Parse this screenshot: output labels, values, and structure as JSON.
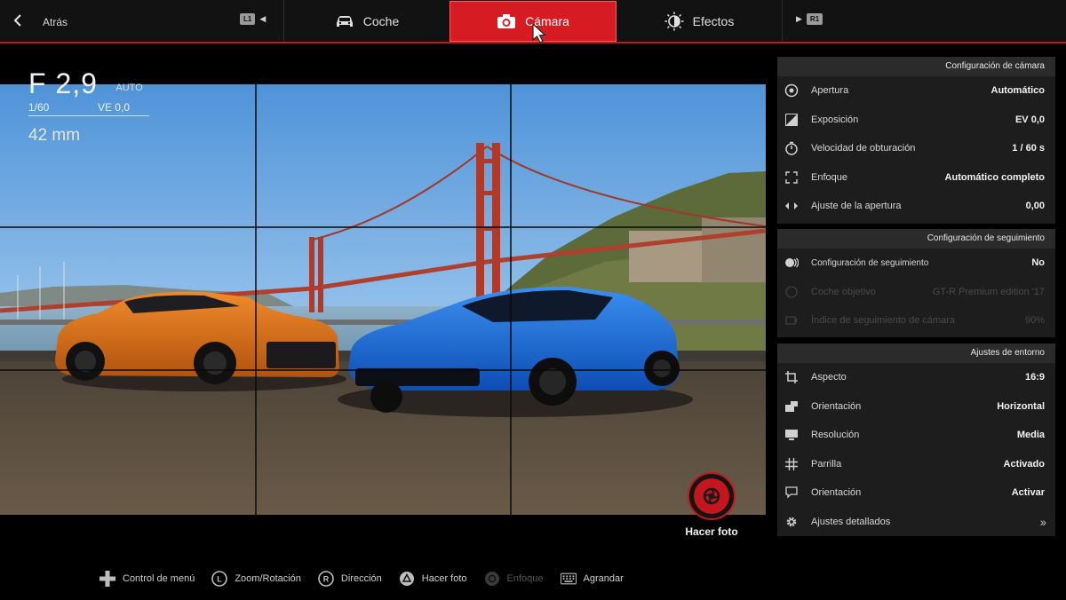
{
  "topbar": {
    "back_label": "Atrás",
    "left_button": "L1",
    "right_button": "R1",
    "tabs": [
      {
        "label": "Coche",
        "icon": "car-icon",
        "active": false
      },
      {
        "label": "Cámara",
        "icon": "camera-icon",
        "active": true
      },
      {
        "label": "Efectos",
        "icon": "effects-icon",
        "active": false
      }
    ],
    "accent": "#d61c22"
  },
  "hud": {
    "aperture": "F 2,9",
    "mode": "AUTO",
    "shutter": "1/60",
    "ev": "VE 0,0",
    "focal": "42 mm"
  },
  "shutter_button": {
    "label": "Hacer foto"
  },
  "camera_settings": {
    "title": "Configuración de cámara",
    "rows": [
      {
        "label": "Apertura",
        "value": "Automático",
        "icon": "aperture-icon"
      },
      {
        "label": "Exposición",
        "value": "EV 0,0",
        "icon": "exposure-icon"
      },
      {
        "label": "Velocidad de obturación",
        "value": "1 / 60 s",
        "icon": "timer-icon"
      },
      {
        "label": "Enfoque",
        "value": "Automático completo",
        "icon": "focus-icon"
      },
      {
        "label": "Ajuste de la apertura",
        "value": "0,00",
        "icon": "aperture-adjust-icon"
      }
    ]
  },
  "tracking_settings": {
    "title": "Configuración de seguimiento",
    "rows": [
      {
        "label": "Configuración de seguimiento",
        "value": "No",
        "icon": "tracking-icon",
        "enabled": true
      },
      {
        "label": "Coche objetivo",
        "value": "GT-R Premium edition '17",
        "icon": "target-icon",
        "enabled": false
      },
      {
        "label": "Índice de seguimiento de cámara",
        "value": "90%",
        "icon": "camera-track-icon",
        "enabled": false
      }
    ]
  },
  "environment_settings": {
    "title": "Ajustes de entorno",
    "rows": [
      {
        "label": "Aspecto",
        "value": "16:9",
        "icon": "crop-icon"
      },
      {
        "label": "Orientación",
        "value": "Horizontal",
        "icon": "orientation-icon"
      },
      {
        "label": "Resolución",
        "value": "Media",
        "icon": "resolution-icon"
      },
      {
        "label": "Parrilla",
        "value": "Activado",
        "icon": "grid-icon"
      },
      {
        "label": "Orientación",
        "value": "Activar",
        "icon": "speech-bubble-icon"
      },
      {
        "label": "Ajustes detallados",
        "value": "",
        "icon": "gear-icon"
      }
    ]
  },
  "hints": [
    {
      "label": "Control de menú",
      "icon": "dpad-icon",
      "enabled": true
    },
    {
      "label": "Zoom/Rotación",
      "icon": "left-stick-icon",
      "enabled": true
    },
    {
      "label": "Dirección",
      "icon": "right-stick-icon",
      "enabled": true
    },
    {
      "label": "Hacer foto",
      "icon": "triangle-button-icon",
      "enabled": true
    },
    {
      "label": "Enfoque",
      "icon": "circle-button-icon",
      "enabled": false
    },
    {
      "label": "Agrandar",
      "icon": "touchpad-icon",
      "enabled": true
    }
  ]
}
